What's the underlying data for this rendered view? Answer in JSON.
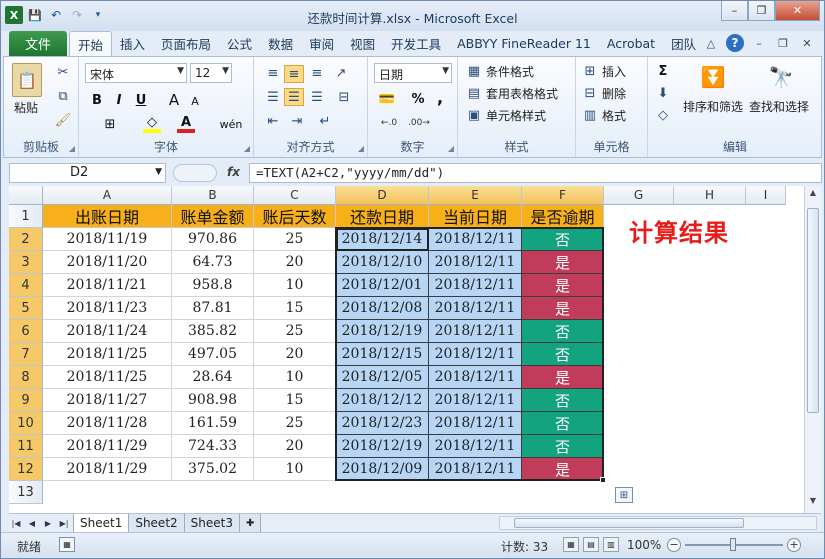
{
  "window": {
    "title": "还款时间计算.xlsx - Microsoft Excel",
    "buttons": {
      "minimize": "–",
      "restore": "❐",
      "close": "✕"
    }
  },
  "qat": {
    "excel_logo": "X",
    "save": "💾",
    "undo": "↶",
    "redo": "↷",
    "more": "▾"
  },
  "tabs": {
    "file": "文件",
    "items": [
      "开始",
      "插入",
      "页面布局",
      "公式",
      "数据",
      "审阅",
      "视图",
      "开发工具",
      "ABBYY FineReader 11",
      "Acrobat",
      "团队"
    ],
    "active_index": 0
  },
  "ribbon": {
    "clipboard": {
      "label": "剪贴板",
      "paste": "粘贴"
    },
    "font": {
      "label": "字体",
      "name": "宋体",
      "size": "12",
      "bold": "B",
      "italic": "I",
      "underline": "U",
      "grow": "A",
      "shrink": "A",
      "font_color": "A",
      "wen": "wén"
    },
    "alignment": {
      "label": "对齐方式"
    },
    "number": {
      "label": "数字",
      "format": "日期",
      "percent": "%",
      "comma": ","
    },
    "styles": {
      "label": "样式",
      "conditional": "条件格式",
      "table": "套用表格格式",
      "cell": "单元格样式"
    },
    "cells": {
      "label": "单元格",
      "insert": "插入",
      "delete": "删除",
      "format": "格式"
    },
    "editing": {
      "label": "编辑",
      "sort": "排序和筛选",
      "find": "查找和选择"
    }
  },
  "formula_bar": {
    "name_box": "D2",
    "fx": "fx",
    "formula": "=TEXT(A2+C2,\"yyyy/mm/dd\")"
  },
  "sheet": {
    "columns": [
      "A",
      "B",
      "C",
      "D",
      "E",
      "F",
      "G",
      "H",
      "I"
    ],
    "rows": [
      "1",
      "2",
      "3",
      "4",
      "5",
      "6",
      "7",
      "8",
      "9",
      "10",
      "11",
      "12",
      "13"
    ],
    "headers": [
      "出账日期",
      "账单金额",
      "账后天数",
      "还款日期",
      "当前日期",
      "是否逾期"
    ],
    "data": [
      [
        "2018/11/19",
        "970.86",
        "25",
        "2018/12/14",
        "2018/12/11",
        "否"
      ],
      [
        "2018/11/20",
        "64.73",
        "20",
        "2018/12/10",
        "2018/12/11",
        "是"
      ],
      [
        "2018/11/21",
        "958.8",
        "10",
        "2018/12/01",
        "2018/12/11",
        "是"
      ],
      [
        "2018/11/23",
        "87.81",
        "15",
        "2018/12/08",
        "2018/12/11",
        "是"
      ],
      [
        "2018/11/24",
        "385.82",
        "25",
        "2018/12/19",
        "2018/12/11",
        "否"
      ],
      [
        "2018/11/25",
        "497.05",
        "20",
        "2018/12/15",
        "2018/12/11",
        "否"
      ],
      [
        "2018/11/25",
        "28.64",
        "10",
        "2018/12/05",
        "2018/12/11",
        "是"
      ],
      [
        "2018/11/27",
        "908.98",
        "15",
        "2018/12/12",
        "2018/12/11",
        "否"
      ],
      [
        "2018/11/28",
        "161.59",
        "25",
        "2018/12/23",
        "2018/12/11",
        "否"
      ],
      [
        "2018/11/29",
        "724.33",
        "20",
        "2018/12/19",
        "2018/12/11",
        "否"
      ],
      [
        "2018/11/29",
        "375.02",
        "10",
        "2018/12/09",
        "2018/12/11",
        "是"
      ]
    ],
    "annotation": "计算结果",
    "colors": {
      "header": "#f7b01a",
      "blue": "#b7d6f5",
      "ok": "#14a37f",
      "late": "#c03c5a",
      "annotation": "#e81b1b"
    }
  },
  "sheet_tabs": [
    "Sheet1",
    "Sheet2",
    "Sheet3"
  ],
  "status": {
    "ready": "就绪",
    "count": "计数: 33",
    "zoom": "100%"
  }
}
